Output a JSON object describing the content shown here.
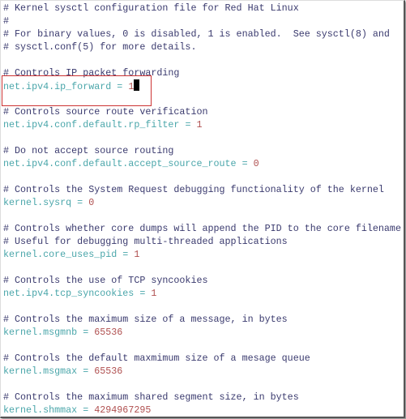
{
  "lines": [
    {
      "type": "comment",
      "text": "# Kernel sysctl configuration file for Red Hat Linux"
    },
    {
      "type": "comment",
      "text": "#"
    },
    {
      "type": "comment",
      "text": "# For binary values, 0 is disabled, 1 is enabled.  See sysctl(8) and"
    },
    {
      "type": "comment",
      "text": "# sysctl.conf(5) for more details."
    },
    {
      "type": "blank",
      "text": ""
    },
    {
      "type": "comment",
      "text": "# Controls IP packet forwarding"
    },
    {
      "type": "setting",
      "key": "net.ipv4.ip_forward",
      "eq": " = ",
      "value": "1"
    },
    {
      "type": "blank",
      "text": ""
    },
    {
      "type": "comment",
      "text": "# Controls source route verification"
    },
    {
      "type": "setting",
      "key": "net.ipv4.conf.default.rp_filter",
      "eq": " = ",
      "value": "1"
    },
    {
      "type": "blank",
      "text": ""
    },
    {
      "type": "comment",
      "text": "# Do not accept source routing"
    },
    {
      "type": "setting",
      "key": "net.ipv4.conf.default.accept_source_route",
      "eq": " = ",
      "value": "0"
    },
    {
      "type": "blank",
      "text": ""
    },
    {
      "type": "comment",
      "text": "# Controls the System Request debugging functionality of the kernel"
    },
    {
      "type": "setting",
      "key": "kernel.sysrq",
      "eq": " = ",
      "value": "0"
    },
    {
      "type": "blank",
      "text": ""
    },
    {
      "type": "comment",
      "text": "# Controls whether core dumps will append the PID to the core filename"
    },
    {
      "type": "comment",
      "text": "# Useful for debugging multi-threaded applications"
    },
    {
      "type": "setting",
      "key": "kernel.core_uses_pid",
      "eq": " = ",
      "value": "1"
    },
    {
      "type": "blank",
      "text": ""
    },
    {
      "type": "comment",
      "text": "# Controls the use of TCP syncookies"
    },
    {
      "type": "setting",
      "key": "net.ipv4.tcp_syncookies",
      "eq": " = ",
      "value": "1"
    },
    {
      "type": "blank",
      "text": ""
    },
    {
      "type": "comment",
      "text": "# Controls the maximum size of a message, in bytes"
    },
    {
      "type": "setting",
      "key": "kernel.msgmnb",
      "eq": " = ",
      "value": "65536"
    },
    {
      "type": "blank",
      "text": ""
    },
    {
      "type": "comment",
      "text": "# Controls the default maxmimum size of a mesage queue"
    },
    {
      "type": "setting",
      "key": "kernel.msgmax",
      "eq": " = ",
      "value": "65536"
    },
    {
      "type": "blank",
      "text": ""
    },
    {
      "type": "comment",
      "text": "# Controls the maximum shared segment size, in bytes"
    },
    {
      "type": "setting",
      "key": "kernel.shmmax",
      "eq": " = ",
      "value": "4294967295"
    }
  ],
  "colors": {
    "comment": "#3a3a6e",
    "key": "#4aa6aa",
    "value": "#b05050",
    "highlight": "#cc3333"
  },
  "cursor_line": 6
}
